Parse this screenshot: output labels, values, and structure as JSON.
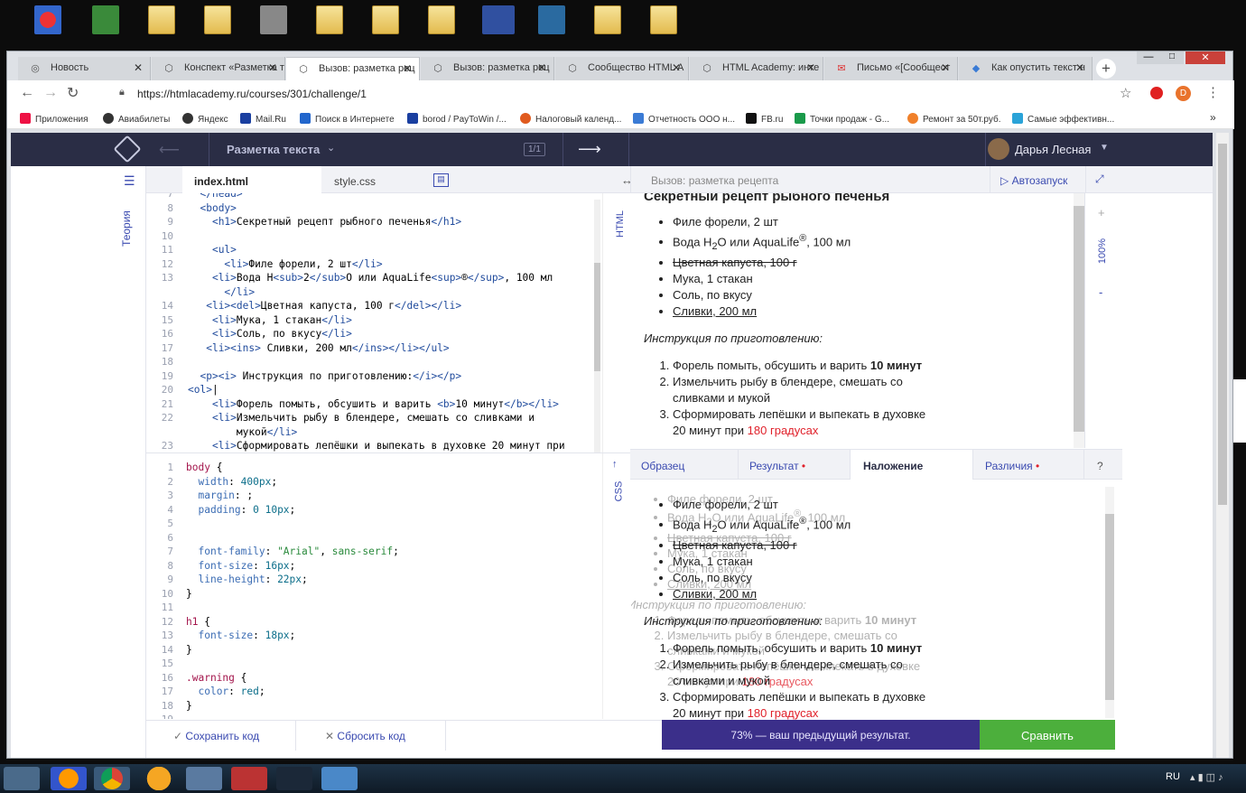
{
  "browser": {
    "tabs": [
      "Новость",
      "Конспект «Разметка т",
      "Вызов: разметка рец",
      "Вызов: разметка рец",
      "Сообщество HTML A",
      "HTML Academy: инте",
      "Письмо «[Сообщест",
      "Как опустить текст н"
    ],
    "url": "https://htmlacademy.ru/courses/301/challenge/1",
    "bookmarks": [
      "Приложения",
      "Авиабилеты",
      "Яндекс",
      "Mail.Ru",
      "Поиск в Интернете",
      "borod / PayToWin /...",
      "Налоговый календ...",
      "Отчетность ООО н...",
      "FB.ru",
      "Точки продаж - G...",
      "Ремонт за 50т.руб.",
      "Самые эффективн..."
    ]
  },
  "app": {
    "section": "Разметка текста",
    "counter": "1/1",
    "user": "Дарья Лесная",
    "theory": "Теория",
    "tabs": {
      "html": "index.html",
      "css": "style.css",
      "html_side": "HTML",
      "css_side": "CSS"
    },
    "preview_title": "Вызов: разметка рецепта",
    "autorun": "Автозапуск",
    "zoom": "100%",
    "result_tabs": [
      "Образец",
      "Результат",
      "Наложение",
      "Различия",
      "?"
    ],
    "save": "Сохранить код",
    "reset": "Сбросить код",
    "score": "73% — ваш предыдущий результат.",
    "compare": "Сравнить"
  },
  "recipe": {
    "h1": "Секретный рецепт рыбного печенья",
    "items": [
      "Филе форели, 2 шт",
      "Вода H",
      "2",
      "O или AquaLife",
      "®",
      ", 100 мл",
      "Цветная капуста, 100 г",
      "Мука, 1 стакан",
      "Соль, по вкусу",
      "Сливки, 200 мл"
    ],
    "instruction": "Инструкция по приготовлению:",
    "step1a": "Форель помыть, обсушить и варить ",
    "step1b": "10 минут",
    "step2": "Измельчить рыбу в блендере, смешать со сливками и мукой",
    "step3a": "Сформировать лепёшки и выпекать в духовке 20 минут при ",
    "step3b": "180 градусах"
  },
  "system": {
    "lang": "RU"
  },
  "colors": {
    "header": "#2a2d45",
    "score_bar": "#3b2f8a",
    "compare": "#4caf3c",
    "warning": "#e0212b"
  }
}
